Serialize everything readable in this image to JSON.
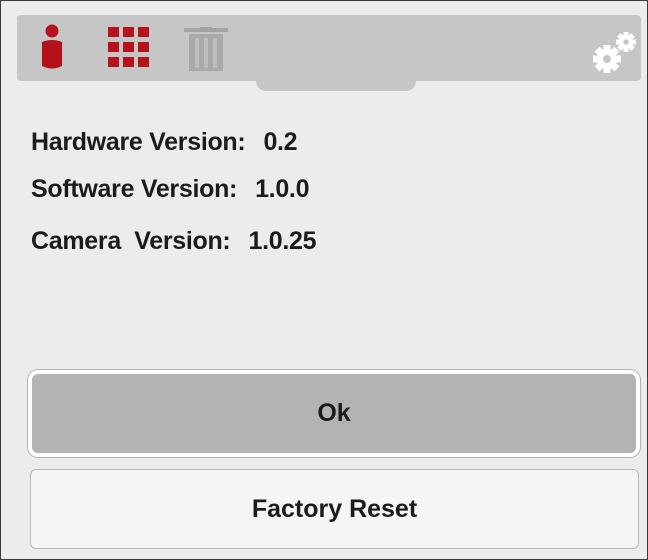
{
  "toolbar": {
    "icons": [
      "info-icon",
      "grid-icon",
      "trash-icon",
      "gears-icon"
    ],
    "accent_color": "#b5121b",
    "disabled_color": "#a3a3a3"
  },
  "info": {
    "hardware_label": "Hardware Version:",
    "hardware_value": "0.2",
    "software_label": "Software Version:",
    "software_value": "1.0.0",
    "camera_label": "Camera  Version:",
    "camera_value": "1.0.25"
  },
  "buttons": {
    "ok_label": "Ok",
    "factory_reset_label": "Factory Reset"
  }
}
